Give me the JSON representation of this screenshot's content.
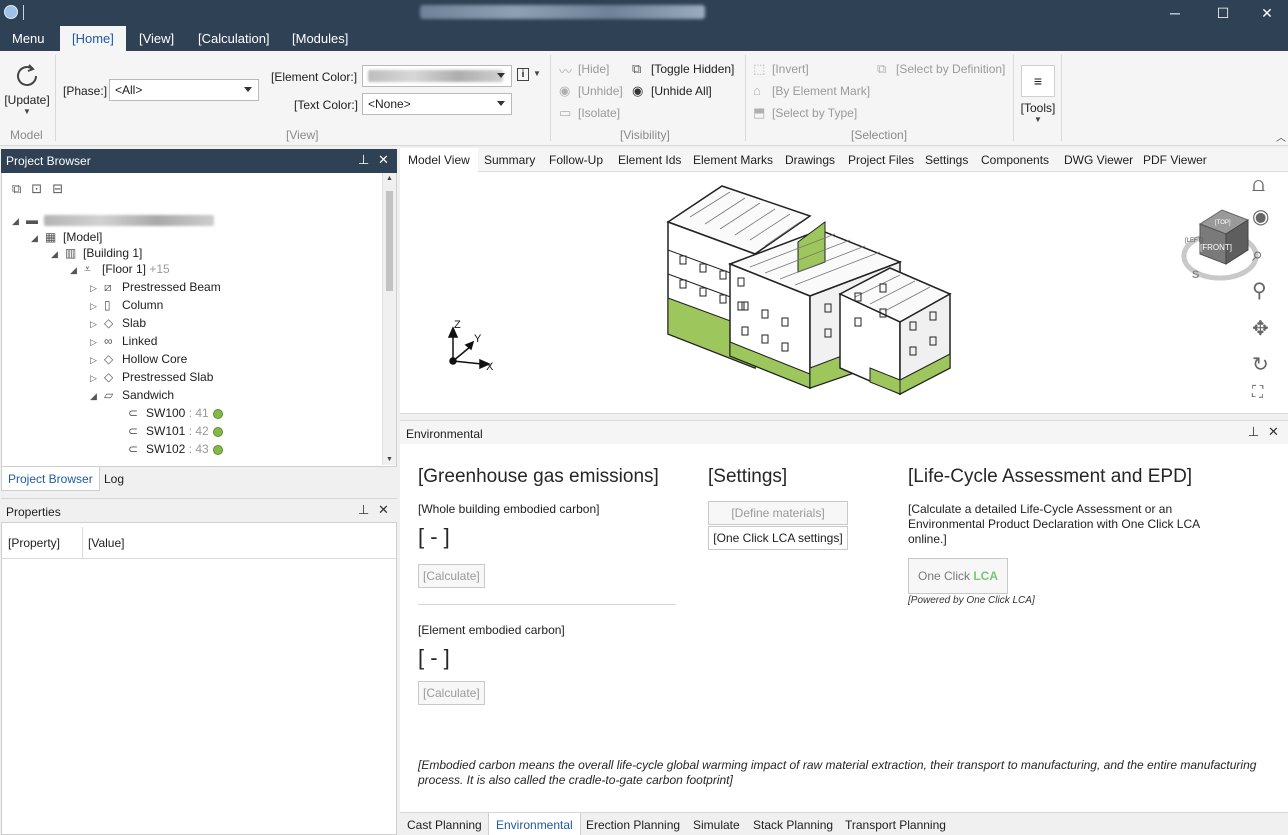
{
  "titlebar": {
    "minimize": "─",
    "maximize": "☐",
    "close": "✕"
  },
  "menu": {
    "menu_label": "Menu",
    "tabs": [
      "[Home]",
      "[View]",
      "[Calculation]",
      "[Modules]"
    ]
  },
  "ribbon": {
    "update_label": "[Update]",
    "model_group": "Model",
    "phase_label": "[Phase:]",
    "phase_value": "<All>",
    "element_color_label": "[Element Color:]",
    "text_color_label": "[Text Color:]",
    "text_color_value": "<None>",
    "view_group": "[View]",
    "hide": "[Hide]",
    "unhide": "[Unhide]",
    "isolate": "[Isolate]",
    "toggle_hidden": "[Toggle Hidden]",
    "unhide_all": "[Unhide All]",
    "visibility_group": "[Visibility]",
    "invert": "[Invert]",
    "by_element_mark": "[By Element Mark]",
    "select_by_type": "[Select by Type]",
    "select_by_definition": "[Select by Definition]",
    "selection_group": "[Selection]",
    "tools_label": "[Tools]"
  },
  "project_browser": {
    "title": "Project Browser",
    "tree": {
      "model": "[Model]",
      "building": "[Building 1]",
      "floor": "[Floor 1]",
      "floor_count": "+15",
      "types": [
        "Prestressed Beam",
        "Column",
        "Slab",
        "Linked",
        "Hollow Core",
        "Prestressed Slab",
        "Sandwich"
      ],
      "elements": [
        {
          "name": "SW100",
          "count": ": 41"
        },
        {
          "name": "SW101",
          "count": ": 42"
        },
        {
          "name": "SW102",
          "count": ": 43"
        }
      ]
    },
    "tabs": [
      "Project Browser",
      "Log"
    ]
  },
  "properties": {
    "title": "Properties",
    "col_property": "[Property]",
    "col_value": "[Value]"
  },
  "view_tabs": [
    "Model View",
    "Summary",
    "Follow-Up",
    "Element Ids",
    "Element Marks",
    "Drawings",
    "Project Files",
    "Settings",
    "Components",
    "DWG Viewer",
    "PDF Viewer"
  ],
  "viewer": {
    "axis_z": "Z",
    "axis_y": "Y",
    "axis_x": "X",
    "cube_face": "[FRONT]",
    "cube_top": "[TOP]",
    "cube_left": "[LEFT]",
    "compass_s": "S"
  },
  "environmental": {
    "title": "Environmental",
    "ghg_heading": "[Greenhouse gas emissions]",
    "whole_label": "[Whole building embodied carbon]",
    "whole_value": "[ - ]",
    "calculate": "[Calculate]",
    "element_label": "[Element embodied carbon]",
    "element_value": "[ - ]",
    "settings_heading": "[Settings]",
    "define_materials": "[Define materials]",
    "oneclick_settings": "[One Click LCA settings]",
    "lca_heading": "[Life-Cycle Assessment and EPD]",
    "lca_desc": "[Calculate a detailed Life-Cycle Assessment or an Environmental Product Declaration with One Click LCA online.]",
    "lca_button_text": "One Click",
    "lca_button_logo": "LCA",
    "powered_by": "[Powered by One Click LCA]",
    "footnote": "[Embodied carbon means the overall life-cycle global warming impact of raw material extraction, their transport to manufacturing, and the entire manufacturing process. It is also called the cradle-to-gate carbon footprint]"
  },
  "bottom_tabs": [
    "Cast Planning",
    "Environmental",
    "Erection Planning",
    "Simulate",
    "Stack Planning",
    "Transport Planning"
  ]
}
